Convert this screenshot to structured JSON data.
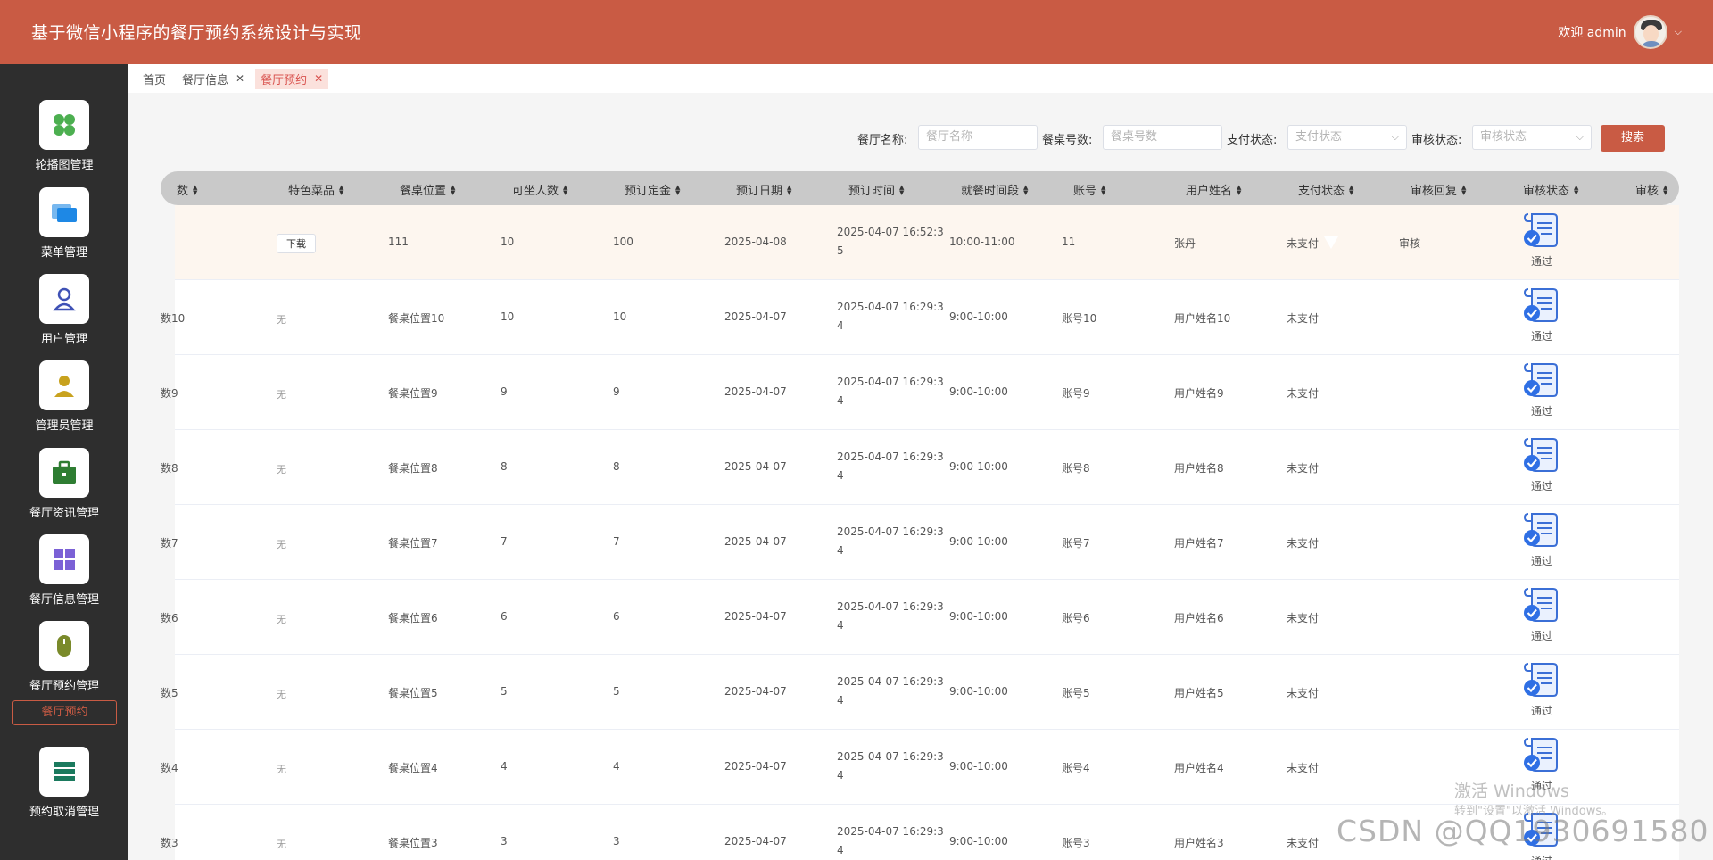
{
  "header": {
    "title": "基于微信小程序的餐厅预约系统设计与实现",
    "welcome": "欢迎 admin"
  },
  "sidebar": {
    "items": [
      {
        "label": "轮播图管理",
        "icon": "apps-icon",
        "color": "#4caf50"
      },
      {
        "label": "菜单管理",
        "icon": "folder-icon",
        "color": "#1e88e5"
      },
      {
        "label": "用户管理",
        "icon": "user-icon",
        "color": "#3f51b5"
      },
      {
        "label": "管理员管理",
        "icon": "admin-icon",
        "color": "#c8a21e"
      },
      {
        "label": "餐厅资讯管理",
        "icon": "briefcase-icon",
        "color": "#2e7d32"
      },
      {
        "label": "餐厅信息管理",
        "icon": "grid-icon",
        "color": "#7b61d6"
      },
      {
        "label": "餐厅预约管理",
        "icon": "mouse-icon",
        "color": "#7a8a2a"
      },
      {
        "label": "预约取消管理",
        "icon": "list-icon",
        "color": "#1b7a5e"
      }
    ],
    "active_sub": "餐厅预约"
  },
  "tags": [
    {
      "label": "首页",
      "closable": false
    },
    {
      "label": "餐厅信息",
      "closable": true
    },
    {
      "label": "餐厅预约",
      "closable": true,
      "active": true
    }
  ],
  "search": {
    "restaurant_label": "餐厅名称:",
    "restaurant_placeholder": "餐厅名称",
    "table_label": "餐桌号数:",
    "table_placeholder": "餐桌号数",
    "pay_label": "支付状态:",
    "pay_placeholder": "支付状态",
    "review_label": "审核状态:",
    "review_placeholder": "审核状态",
    "button": "搜索"
  },
  "table": {
    "headers": [
      "数",
      "特色菜品",
      "餐桌位置",
      "可坐人数",
      "预订定金",
      "预订日期",
      "预订时间",
      "就餐时间段",
      "账号",
      "用户姓名",
      "支付状态",
      "审核回复",
      "审核状态",
      "审核"
    ],
    "rows": [
      {
        "num": "",
        "dish": "下载",
        "position": "111",
        "seats": "10",
        "deposit": "100",
        "date": "2025-04-08",
        "time1": "2025-04-07 16:52:3",
        "time2": "5",
        "slot": "10:00-11:00",
        "account": "11",
        "name": "张丹",
        "pay": "未支付",
        "reply": "审核",
        "status": "通过"
      },
      {
        "num": "数10",
        "dish": "无",
        "position": "餐桌位置10",
        "seats": "10",
        "deposit": "10",
        "date": "2025-04-07",
        "time1": "2025-04-07 16:29:3",
        "time2": "4",
        "slot": "9:00-10:00",
        "account": "账号10",
        "name": "用户姓名10",
        "pay": "未支付",
        "reply": "",
        "status": "通过"
      },
      {
        "num": "数9",
        "dish": "无",
        "position": "餐桌位置9",
        "seats": "9",
        "deposit": "9",
        "date": "2025-04-07",
        "time1": "2025-04-07 16:29:3",
        "time2": "4",
        "slot": "9:00-10:00",
        "account": "账号9",
        "name": "用户姓名9",
        "pay": "未支付",
        "reply": "",
        "status": "通过"
      },
      {
        "num": "数8",
        "dish": "无",
        "position": "餐桌位置8",
        "seats": "8",
        "deposit": "8",
        "date": "2025-04-07",
        "time1": "2025-04-07 16:29:3",
        "time2": "4",
        "slot": "9:00-10:00",
        "account": "账号8",
        "name": "用户姓名8",
        "pay": "未支付",
        "reply": "",
        "status": "通过"
      },
      {
        "num": "数7",
        "dish": "无",
        "position": "餐桌位置7",
        "seats": "7",
        "deposit": "7",
        "date": "2025-04-07",
        "time1": "2025-04-07 16:29:3",
        "time2": "4",
        "slot": "9:00-10:00",
        "account": "账号7",
        "name": "用户姓名7",
        "pay": "未支付",
        "reply": "",
        "status": "通过"
      },
      {
        "num": "数6",
        "dish": "无",
        "position": "餐桌位置6",
        "seats": "6",
        "deposit": "6",
        "date": "2025-04-07",
        "time1": "2025-04-07 16:29:3",
        "time2": "4",
        "slot": "9:00-10:00",
        "account": "账号6",
        "name": "用户姓名6",
        "pay": "未支付",
        "reply": "",
        "status": "通过"
      },
      {
        "num": "数5",
        "dish": "无",
        "position": "餐桌位置5",
        "seats": "5",
        "deposit": "5",
        "date": "2025-04-07",
        "time1": "2025-04-07 16:29:3",
        "time2": "4",
        "slot": "9:00-10:00",
        "account": "账号5",
        "name": "用户姓名5",
        "pay": "未支付",
        "reply": "",
        "status": "通过"
      },
      {
        "num": "数4",
        "dish": "无",
        "position": "餐桌位置4",
        "seats": "4",
        "deposit": "4",
        "date": "2025-04-07",
        "time1": "2025-04-07 16:29:3",
        "time2": "4",
        "slot": "9:00-10:00",
        "account": "账号4",
        "name": "用户姓名4",
        "pay": "未支付",
        "reply": "",
        "status": "通过"
      },
      {
        "num": "数3",
        "dish": "无",
        "position": "餐桌位置3",
        "seats": "3",
        "deposit": "3",
        "date": "2025-04-07",
        "time1": "2025-04-07 16:29:3",
        "time2": "4",
        "slot": "9:00-10:00",
        "account": "账号3",
        "name": "用户姓名3",
        "pay": "未支付",
        "reply": "",
        "status": "通过"
      }
    ]
  },
  "watermark": {
    "activate_title": "激活 Windows",
    "activate_sub": "转到\"设置\"以激活 Windows。",
    "csdn": "CSDN @QQ1930691580"
  },
  "colors": {
    "brand": "#c95b44",
    "sidebar": "#2e2e2e",
    "header_row": "#c9c9c9",
    "highlight_row": "#fdf6ef"
  }
}
